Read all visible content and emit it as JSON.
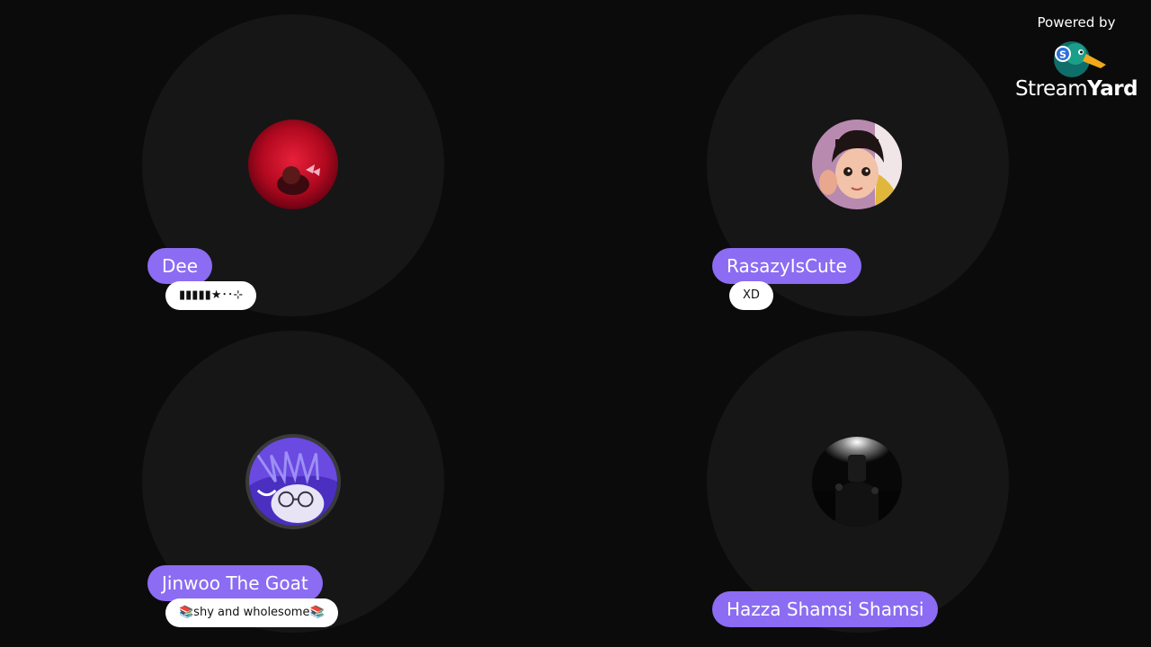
{
  "branding": {
    "powered_by": "Powered by",
    "wordmark_light": "Stream",
    "wordmark_bold": "Yard",
    "logo_icon": "duck-logo-icon"
  },
  "participants": [
    {
      "name": "Dee",
      "status": "▮▮▮▮▮★･･⊹",
      "avatar_icon": "red-avatar-image"
    },
    {
      "name": "RasazyIsCute",
      "status": "XD",
      "avatar_icon": "cartoon-girl-avatar-image"
    },
    {
      "name": "Jinwoo The Goat",
      "status": "📚shy and wholesome📚",
      "avatar_icon": "anime-boy-avatar-image"
    },
    {
      "name": "Hazza Shamsi Shamsi",
      "status": "",
      "avatar_icon": "dark-figure-avatar-image"
    }
  ],
  "colors": {
    "background": "#0b0b0b",
    "tile": "#161616",
    "name_pill": "#8b6cf2",
    "status_pill": "#ffffff"
  }
}
